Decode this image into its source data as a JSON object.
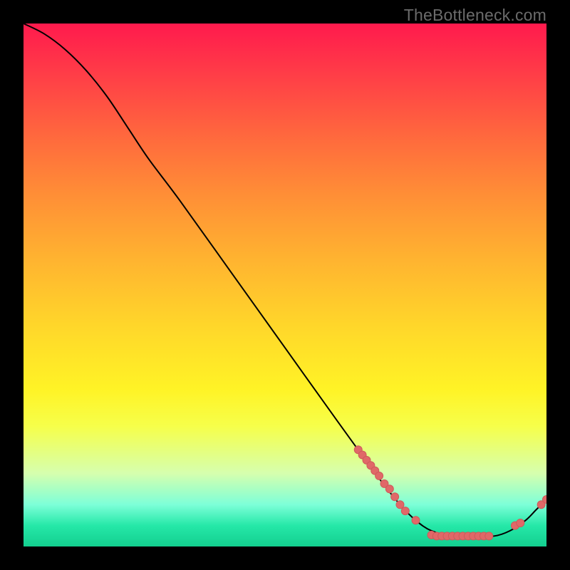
{
  "branding": {
    "text": "TheBottleneck.com"
  },
  "colors": {
    "curve_stroke": "#000000",
    "marker_fill": "#e06868",
    "marker_stroke": "#ce5a5a"
  },
  "chart_data": {
    "type": "line",
    "title": "",
    "xlabel": "",
    "ylabel": "",
    "xlim": [
      0,
      100
    ],
    "ylim": [
      0,
      100
    ],
    "series": [
      {
        "name": "curve",
        "x": [
          0,
          4,
          8,
          12,
          16,
          20,
          24,
          30,
          40,
          50,
          60,
          68,
          72,
          75,
          78,
          82,
          86,
          90,
          93,
          96,
          98,
          100
        ],
        "y": [
          100,
          98,
          95,
          91,
          86,
          80,
          74,
          66,
          52,
          38,
          24,
          13,
          8,
          5,
          3,
          2,
          2,
          2,
          3,
          5,
          7,
          9
        ]
      }
    ],
    "markers": [
      {
        "x": 64.0,
        "y": 18.5
      },
      {
        "x": 64.8,
        "y": 17.5
      },
      {
        "x": 65.6,
        "y": 16.5
      },
      {
        "x": 66.4,
        "y": 15.5
      },
      {
        "x": 67.2,
        "y": 14.5
      },
      {
        "x": 68.0,
        "y": 13.5
      },
      {
        "x": 69.0,
        "y": 12.0
      },
      {
        "x": 70.0,
        "y": 11.0
      },
      {
        "x": 71.0,
        "y": 9.5
      },
      {
        "x": 72.0,
        "y": 8.0
      },
      {
        "x": 73.0,
        "y": 6.8
      },
      {
        "x": 75.0,
        "y": 5.0
      },
      {
        "x": 78.0,
        "y": 2.2
      },
      {
        "x": 79.0,
        "y": 2.0
      },
      {
        "x": 80.0,
        "y": 2.0
      },
      {
        "x": 81.0,
        "y": 2.0
      },
      {
        "x": 82.0,
        "y": 2.0
      },
      {
        "x": 83.0,
        "y": 2.0
      },
      {
        "x": 84.0,
        "y": 2.0
      },
      {
        "x": 85.0,
        "y": 2.0
      },
      {
        "x": 86.0,
        "y": 2.0
      },
      {
        "x": 87.0,
        "y": 2.0
      },
      {
        "x": 88.0,
        "y": 2.0
      },
      {
        "x": 89.0,
        "y": 2.0
      },
      {
        "x": 94.0,
        "y": 4.0
      },
      {
        "x": 95.0,
        "y": 4.5
      },
      {
        "x": 99.0,
        "y": 8.0
      },
      {
        "x": 100.0,
        "y": 9.0
      }
    ]
  }
}
